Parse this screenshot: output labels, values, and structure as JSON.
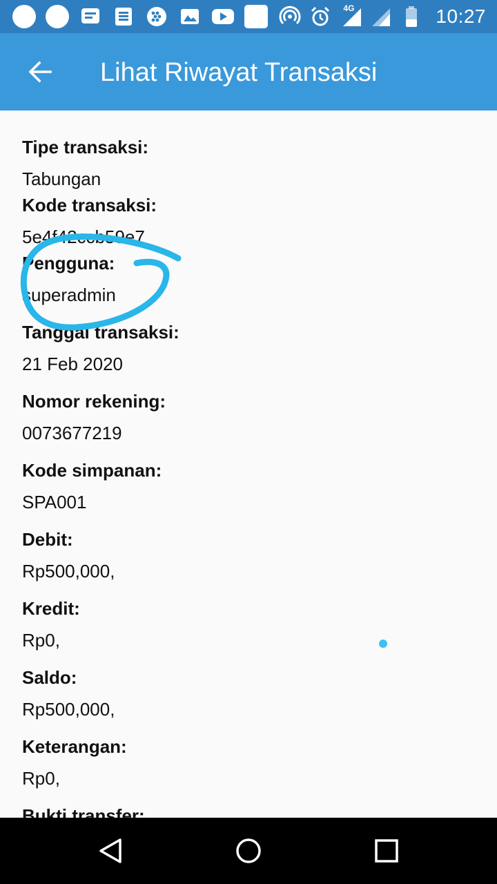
{
  "status_bar": {
    "time": "10:27",
    "network": "4G",
    "icons": [
      "notification-dot",
      "notification-dot",
      "message-icon",
      "document-icon",
      "blackberry-icon",
      "image-icon",
      "youtube-icon",
      "app-icon",
      "hotspot-icon",
      "alarm-icon",
      "signal-4g-icon",
      "signal-icon",
      "battery-icon"
    ]
  },
  "app_bar": {
    "title": "Lihat Riwayat Transaksi",
    "back_icon": "arrow-left-icon",
    "color": "#3999db"
  },
  "fields": [
    {
      "label": "Tipe transaksi:",
      "value": "Tabungan"
    },
    {
      "label": "Kode transaksi:",
      "value": "5e4f42ccb59e7"
    },
    {
      "label": "Pengguna:",
      "value": "superadmin"
    },
    {
      "label": "Tanggal transaksi:",
      "value": "21 Feb 2020"
    },
    {
      "label": "Nomor rekening:",
      "value": "0073677219"
    },
    {
      "label": "Kode simpanan:",
      "value": "SPA001"
    },
    {
      "label": "Debit:",
      "value": "Rp500,000,"
    },
    {
      "label": "Kredit:",
      "value": "Rp0,"
    },
    {
      "label": "Saldo:",
      "value": "Rp500,000,"
    },
    {
      "label": "Keterangan:",
      "value": "Rp0,"
    },
    {
      "label": "Bukti transfer:",
      "value": ""
    }
  ],
  "annotation_color": "#29b6e8",
  "nav_bar": {
    "icons": [
      "back-triangle-icon",
      "home-circle-icon",
      "recents-square-icon"
    ]
  }
}
